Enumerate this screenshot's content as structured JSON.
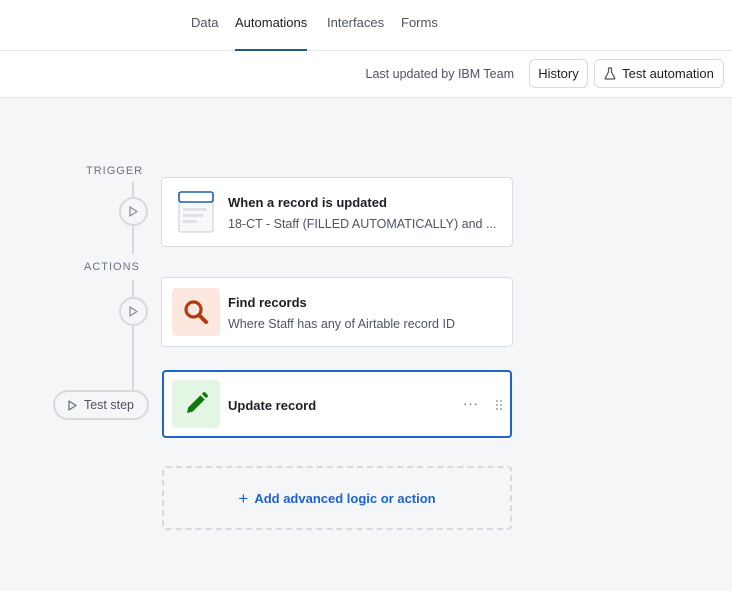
{
  "nav": {
    "tabs": [
      {
        "label": "Data",
        "active": false
      },
      {
        "label": "Automations",
        "active": true
      },
      {
        "label": "Interfaces",
        "active": false
      },
      {
        "label": "Forms",
        "active": false
      }
    ]
  },
  "toolbar": {
    "last_updated": "Last updated by IBM Team",
    "history_label": "History",
    "test_automation_label": "Test automation",
    "test_automation_icon": "flask-icon"
  },
  "flow": {
    "trigger_label": "TRIGGER",
    "actions_label": "ACTIONS",
    "trigger": {
      "title": "When a record is updated",
      "subtitle": "18-CT - Staff (FILLED AUTOMATICALLY) and ...",
      "icon": "record-form-icon"
    },
    "actions": [
      {
        "title": "Find records",
        "subtitle": "Where Staff has any of Airtable record ID",
        "icon": "search-icon",
        "icon_bg": "#fde8df",
        "icon_color": "#b33a11"
      },
      {
        "title": "Update record",
        "subtitle": "",
        "icon": "pencil-icon",
        "icon_bg": "#e3f6e3",
        "icon_color": "#0e7a0e",
        "selected": true,
        "more": "···"
      }
    ],
    "test_step_label": "Test step",
    "add_label": "Add advanced logic or action",
    "add_symbol": "+"
  },
  "colors": {
    "accent": "#1e63c9",
    "tab_underline": "#1f5e78",
    "connector": "#d6d9e0"
  }
}
